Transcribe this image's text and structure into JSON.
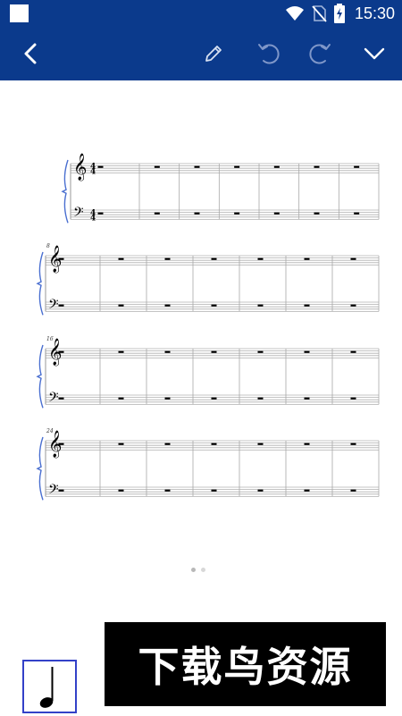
{
  "status_bar": {
    "time": "15:30",
    "icons": [
      "notification-square-icon",
      "wifi-icon",
      "no-sim-icon",
      "battery-charging-icon"
    ]
  },
  "toolbar": {
    "icons": [
      "back-icon",
      "edit-pencil-icon",
      "undo-icon",
      "redo-icon",
      "chevron-down-icon"
    ],
    "background": "#0b3a8c"
  },
  "score": {
    "time_signature": {
      "upper": "4",
      "lower": "4"
    },
    "systems": [
      {
        "measure_number": ""
      },
      {
        "measure_number": "8"
      },
      {
        "measure_number": "16"
      },
      {
        "measure_number": "24"
      }
    ],
    "measures_per_system": 7
  },
  "pager": {
    "pages": 2,
    "current": 1
  },
  "note_palette": {
    "selected": "quarter-note-icon"
  },
  "watermark": {
    "text": "下载鸟资源"
  }
}
